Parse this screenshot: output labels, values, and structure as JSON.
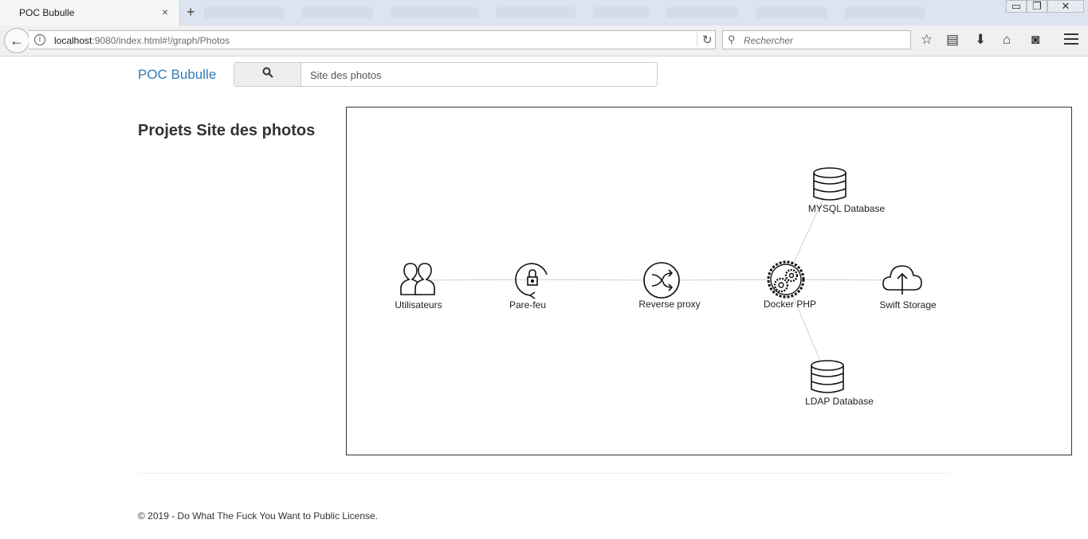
{
  "browser": {
    "tab_title": "POC Bubulle",
    "tab_close": "×",
    "new_tab": "+",
    "url_host": "localhost",
    "url_rest": ":9080/index.html#!/graph/Photos",
    "search_placeholder": "Rechercher",
    "window_controls": [
      "minimize",
      "restore",
      "close"
    ]
  },
  "header": {
    "brand": "POC Bubulle",
    "search_value": "Site des photos"
  },
  "main": {
    "title": "Projets Site des photos"
  },
  "graph": {
    "nodes": [
      {
        "id": "users",
        "label": "Utilisateurs",
        "icon": "users-icon"
      },
      {
        "id": "firewall",
        "label": "Pare-feu",
        "icon": "firewall-lock-icon"
      },
      {
        "id": "proxy",
        "label": "Reverse proxy",
        "icon": "shuffle-proxy-icon"
      },
      {
        "id": "docker",
        "label": "Docker PHP",
        "icon": "gears-icon"
      },
      {
        "id": "swift",
        "label": "Swift Storage",
        "icon": "cloud-upload-icon"
      },
      {
        "id": "mysql",
        "label": "MYSQL Database",
        "icon": "database-icon"
      },
      {
        "id": "ldap",
        "label": "LDAP Database",
        "icon": "database-icon"
      }
    ],
    "edges": [
      [
        "users",
        "firewall"
      ],
      [
        "firewall",
        "proxy"
      ],
      [
        "proxy",
        "docker"
      ],
      [
        "docker",
        "swift"
      ],
      [
        "docker",
        "mysql"
      ],
      [
        "docker",
        "ldap"
      ]
    ]
  },
  "footer": {
    "text": "© 2019 - Do What The Fuck You Want to Public License."
  },
  "colors": {
    "brand_link": "#337ab7",
    "edge": "#d0d0d0",
    "text": "#333333"
  }
}
